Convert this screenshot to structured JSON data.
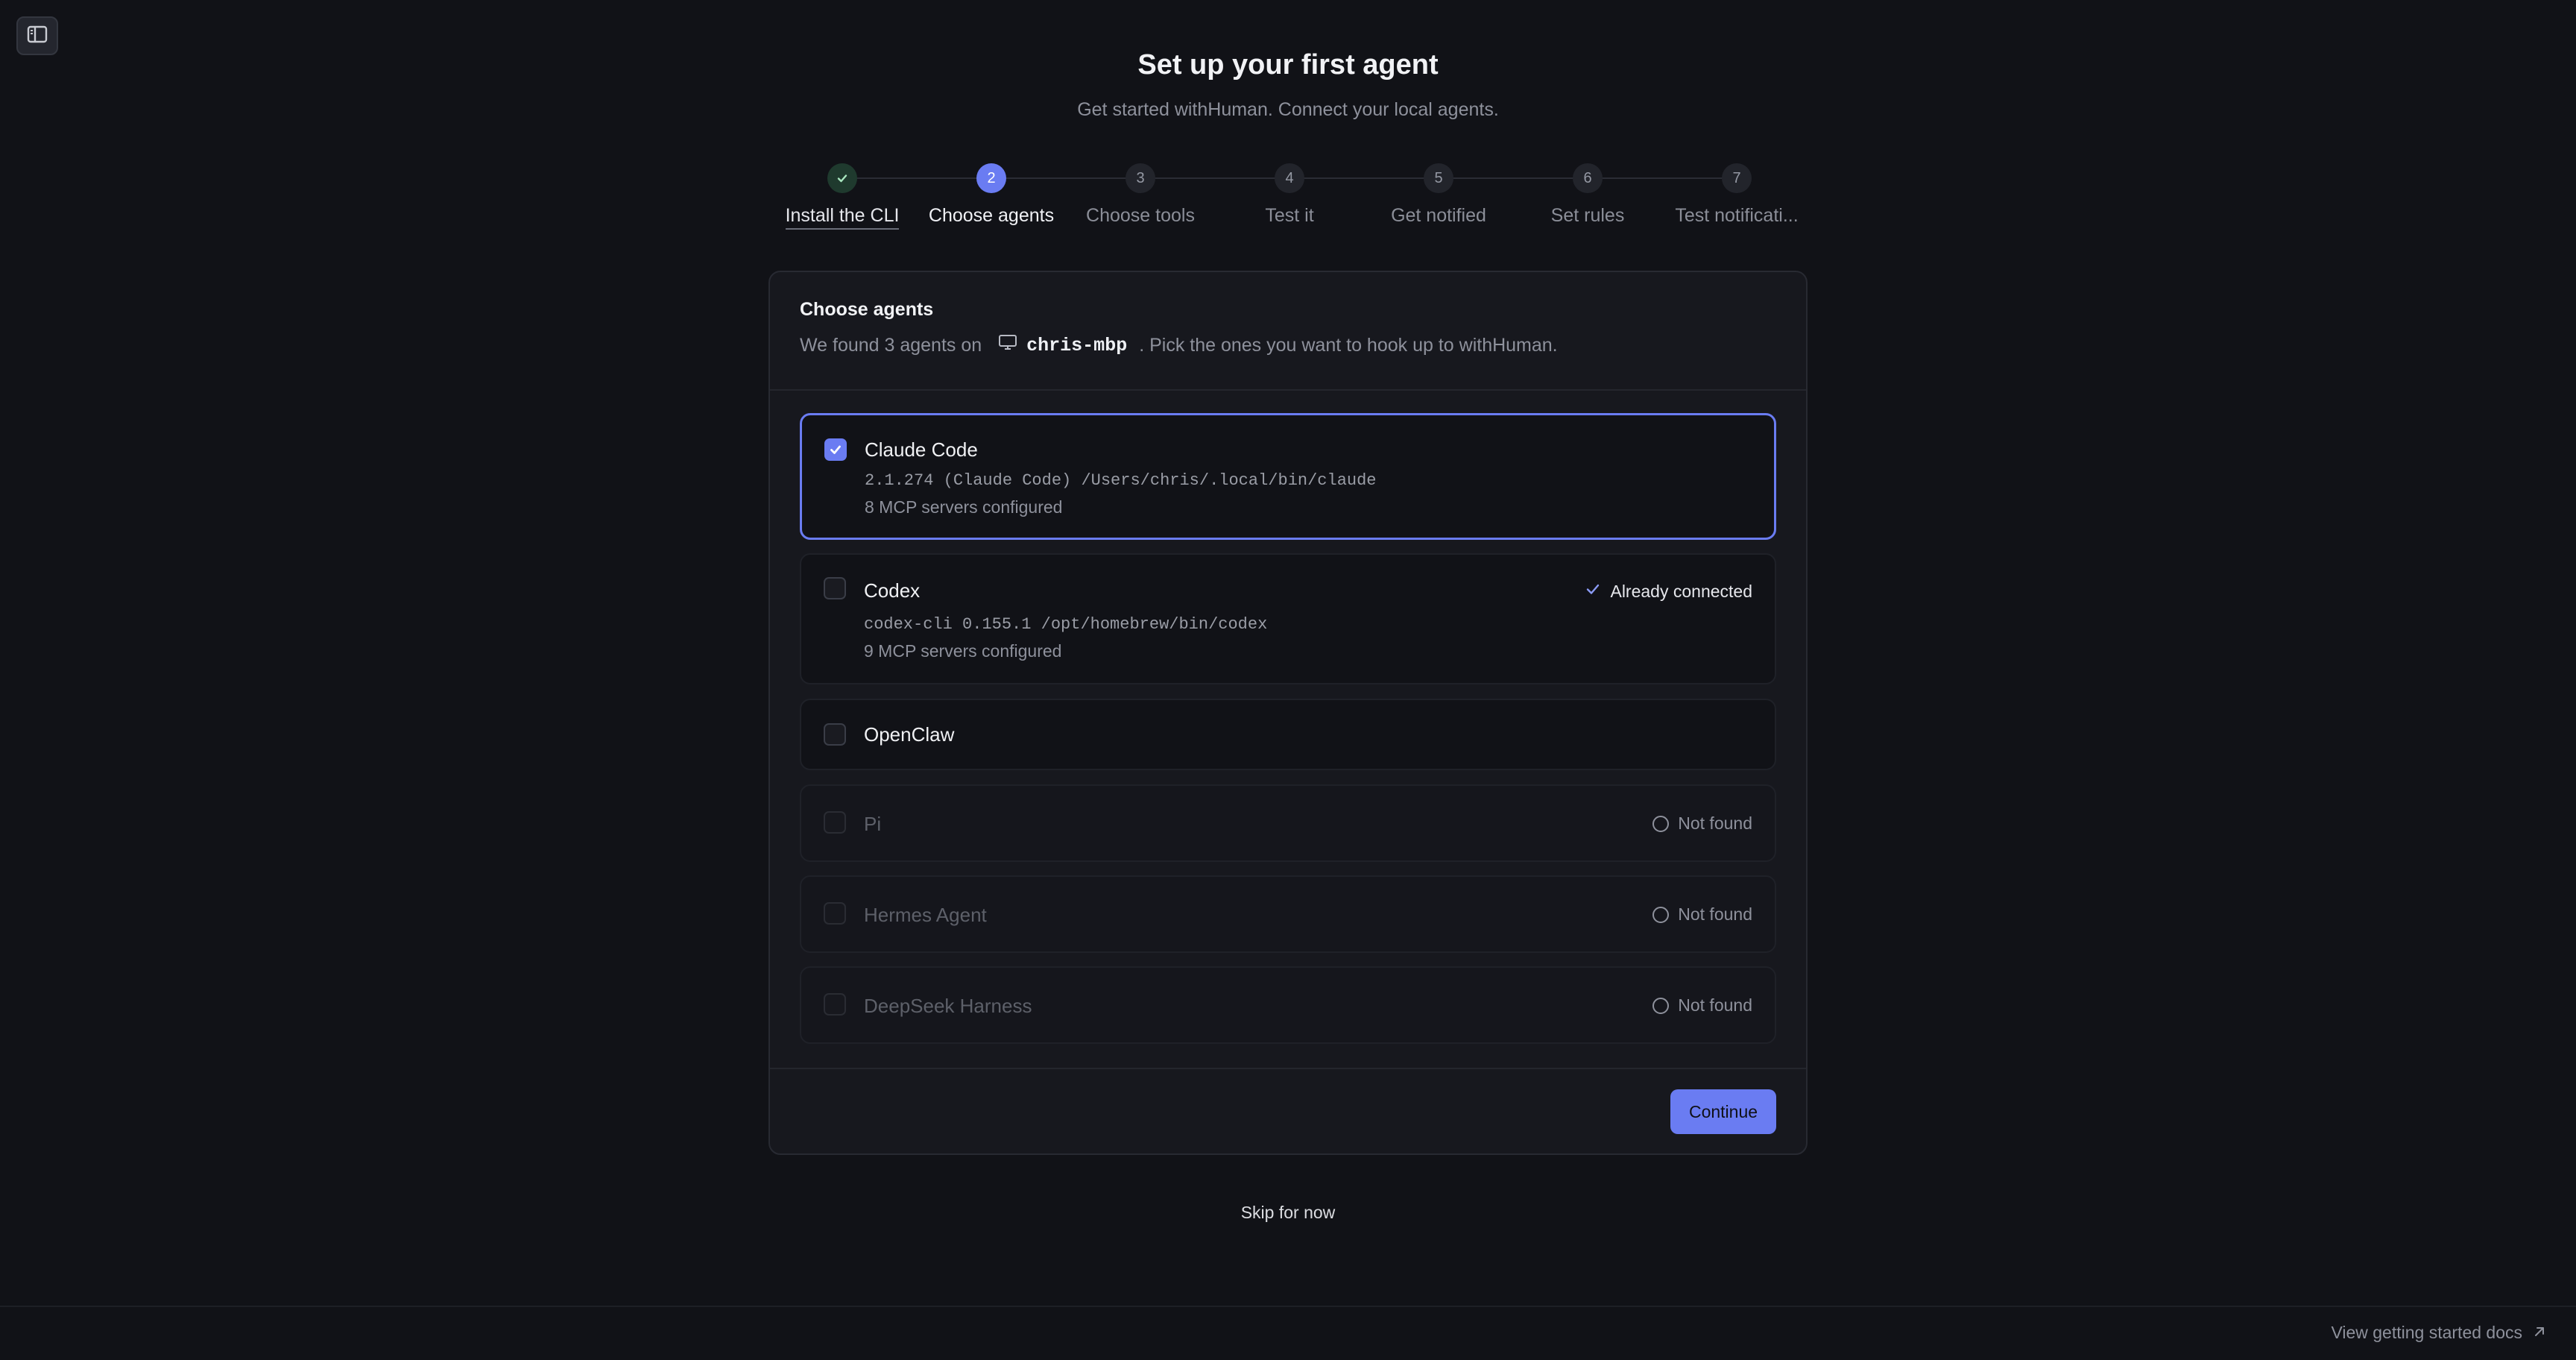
{
  "header": {
    "title": "Set up your first agent",
    "subtitle": "Get started withHuman. Connect your local agents."
  },
  "stepper": {
    "steps": [
      {
        "number": "1",
        "label": "Install the CLI",
        "state": "done"
      },
      {
        "number": "2",
        "label": "Choose agents",
        "state": "active"
      },
      {
        "number": "3",
        "label": "Choose tools",
        "state": "pending"
      },
      {
        "number": "4",
        "label": "Test it",
        "state": "pending"
      },
      {
        "number": "5",
        "label": "Get notified",
        "state": "pending"
      },
      {
        "number": "6",
        "label": "Set rules",
        "state": "pending"
      },
      {
        "number": "7",
        "label": "Test notificati...",
        "state": "pending"
      }
    ]
  },
  "card": {
    "title": "Choose agents",
    "desc_prefix": "We found 3 agents on",
    "host": "chris-mbp",
    "desc_suffix": ". Pick the ones you want to hook up to withHuman.",
    "agents": [
      {
        "name": "Claude Code",
        "checked": true,
        "detail": "2.1.274 (Claude Code) /Users/chris/.local/bin/claude",
        "meta": "8 MCP servers configured",
        "status": ""
      },
      {
        "name": "Codex",
        "checked": false,
        "detail": "codex-cli 0.155.1 /opt/homebrew/bin/codex",
        "meta": "9 MCP servers configured",
        "status": "Already connected"
      },
      {
        "name": "OpenClaw",
        "checked": false,
        "detail": "",
        "meta": "",
        "status": ""
      },
      {
        "name": "Pi",
        "checked": false,
        "detail": "",
        "meta": "",
        "status": "Not found"
      },
      {
        "name": "Hermes Agent",
        "checked": false,
        "detail": "",
        "meta": "",
        "status": "Not found"
      },
      {
        "name": "DeepSeek Harness",
        "checked": false,
        "detail": "",
        "meta": "",
        "status": "Not found"
      }
    ],
    "continue_label": "Continue"
  },
  "skip_label": "Skip for now",
  "footer": {
    "docs_label": "View getting started docs"
  },
  "colors": {
    "background": "#111217",
    "accent": "#6a7cf2",
    "done_step": "#1f3a2e"
  }
}
